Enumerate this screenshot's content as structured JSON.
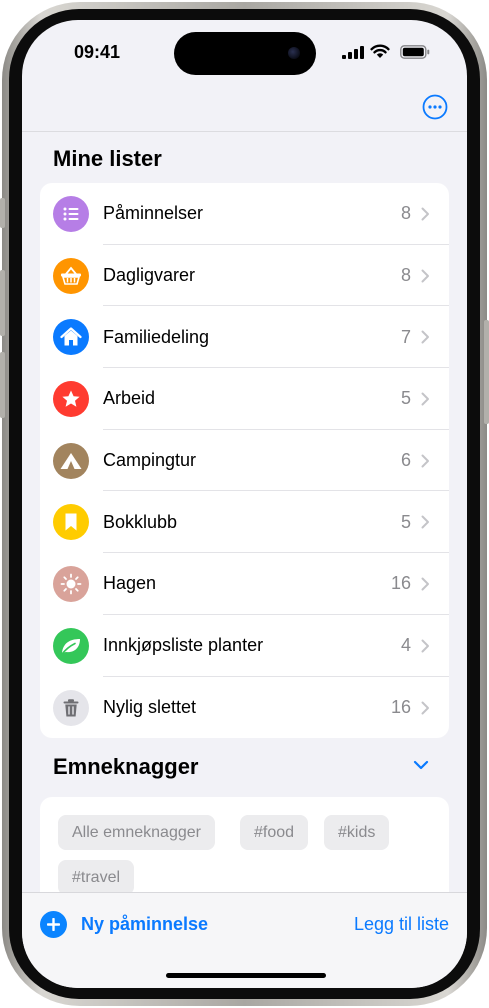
{
  "status_bar": {
    "time": "09:41"
  },
  "header": {
    "more_icon": "ellipsis-circle-icon"
  },
  "lists_section": {
    "title": "Mine lister",
    "items": [
      {
        "label": "Påminnelser",
        "count": "8",
        "icon": "list-bullet-icon",
        "color": "#b67ee6"
      },
      {
        "label": "Dagligvarer",
        "count": "8",
        "icon": "basket-icon",
        "color": "#ff9500"
      },
      {
        "label": "Familiedeling",
        "count": "7",
        "icon": "house-icon",
        "color": "#0a7aff"
      },
      {
        "label": "Arbeid",
        "count": "5",
        "icon": "star-icon",
        "color": "#ff3b30"
      },
      {
        "label": "Campingtur",
        "count": "6",
        "icon": "tent-icon",
        "color": "#a2845e"
      },
      {
        "label": "Bokklubb",
        "count": "5",
        "icon": "bookmark-icon",
        "color": "#ffcc00"
      },
      {
        "label": "Hagen",
        "count": "16",
        "icon": "sun-icon",
        "color": "#d9a39a"
      },
      {
        "label": "Innkjøpsliste planter",
        "count": "4",
        "icon": "leaf-icon",
        "color": "#34c759"
      },
      {
        "label": "Nylig slettet",
        "count": "16",
        "icon": "trash-icon",
        "color": "#e5e5ea"
      }
    ]
  },
  "tags_section": {
    "title": "Emneknagger",
    "chevron_icon": "chevron-down-icon",
    "tags": [
      "Alle emneknagger",
      "#food",
      "#kids",
      "#travel"
    ]
  },
  "bottom_bar": {
    "new_reminder": "Ny påminnelse",
    "add_list": "Legg til liste"
  },
  "colors": {
    "accent": "#0a7aff",
    "background": "#f2f2f7"
  }
}
